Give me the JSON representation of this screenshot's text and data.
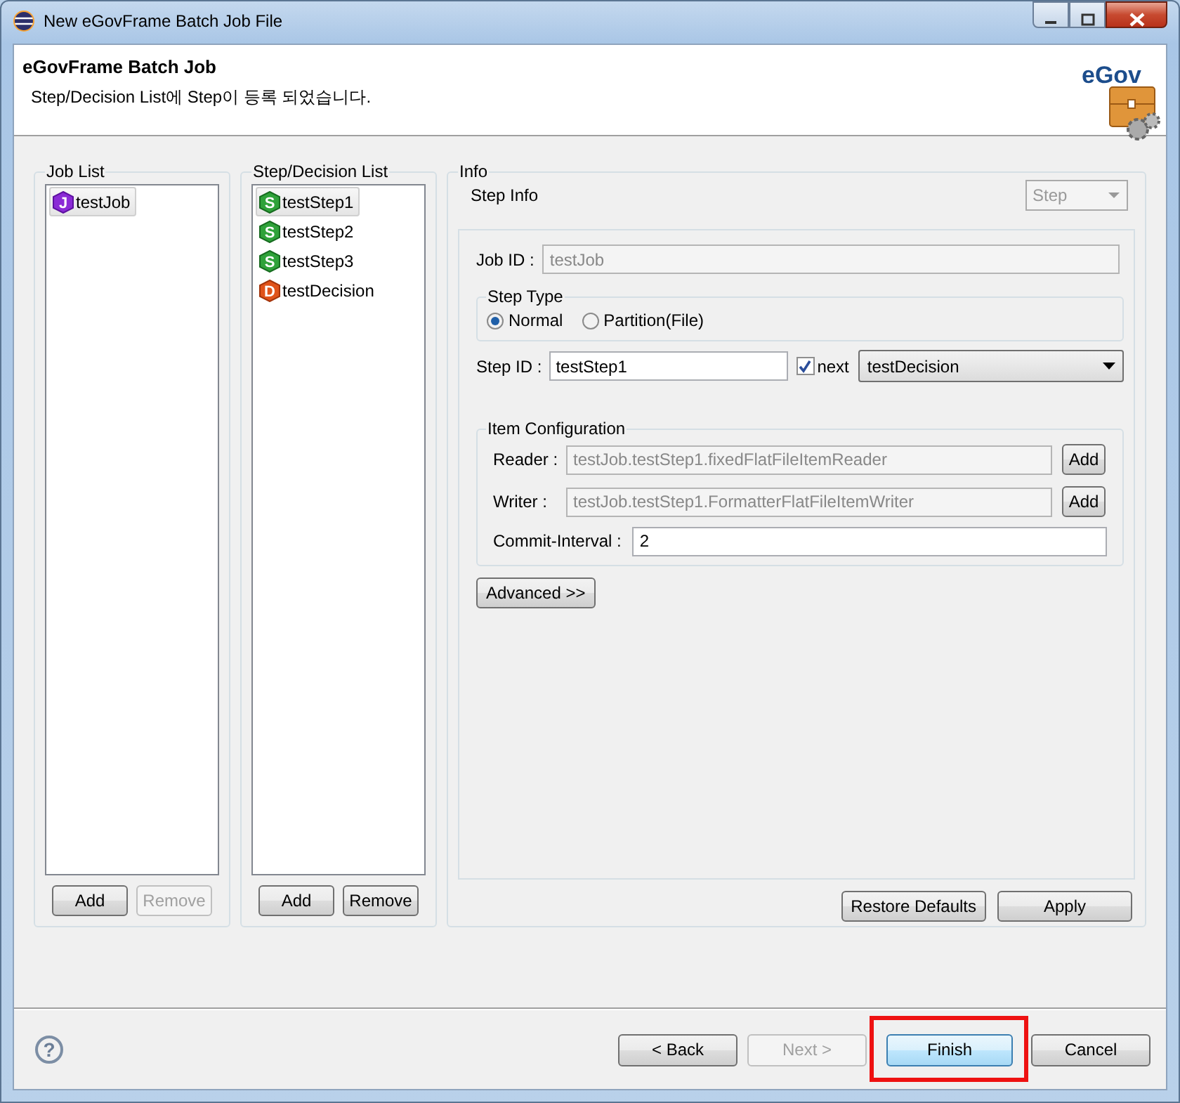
{
  "window": {
    "title": "New eGovFrame Batch Job File"
  },
  "header": {
    "title": "eGovFrame Batch Job",
    "message": "Step/Decision List에 Step이 등록 되었습니다.",
    "logo_text": "eGov"
  },
  "job_list": {
    "label": "Job List",
    "items": [
      {
        "badge": "J",
        "name": "testJob",
        "kind": "job",
        "selected": true
      }
    ],
    "buttons": [
      {
        "label": "Add",
        "disabled": false
      },
      {
        "label": "Remove",
        "disabled": true
      }
    ]
  },
  "step_list": {
    "label": "Step/Decision List",
    "items": [
      {
        "badge": "S",
        "name": "testStep1",
        "kind": "step",
        "selected": true
      },
      {
        "badge": "S",
        "name": "testStep2",
        "kind": "step",
        "selected": false
      },
      {
        "badge": "S",
        "name": "testStep3",
        "kind": "step",
        "selected": false
      },
      {
        "badge": "D",
        "name": "testDecision",
        "kind": "decision",
        "selected": false
      }
    ],
    "buttons": [
      {
        "label": "Add",
        "disabled": false
      },
      {
        "label": "Remove",
        "disabled": false
      }
    ]
  },
  "info": {
    "label": "Info",
    "section": "Step Info",
    "type_combo": {
      "value": "Step",
      "disabled": true
    },
    "job_id": {
      "label": "Job ID :",
      "value": "testJob",
      "disabled": true
    },
    "step_type": {
      "label": "Step Type",
      "options": [
        {
          "label": "Normal",
          "selected": true
        },
        {
          "label": "Partition(File)",
          "selected": false
        }
      ]
    },
    "step_id": {
      "label": "Step ID :",
      "value": "testStep1"
    },
    "next": {
      "label": "next",
      "checked": true,
      "value": "testDecision"
    },
    "item_config": {
      "label": "Item Configuration",
      "rows": [
        {
          "label": "Reader :",
          "value": "testJob.testStep1.fixedFlatFileItemReader",
          "button": "Add"
        },
        {
          "label": "Writer :",
          "value": "testJob.testStep1.FormatterFlatFileItemWriter",
          "button": "Add"
        }
      ],
      "commit": {
        "label": "Commit-Interval :",
        "value": "2"
      }
    },
    "advanced": "Advanced >>",
    "buttons": [
      {
        "label": "Restore Defaults"
      },
      {
        "label": "Apply"
      }
    ]
  },
  "footer": {
    "help": "?",
    "buttons": [
      {
        "label": "< Back",
        "disabled": false,
        "default": false,
        "highlighted": false
      },
      {
        "label": "Next >",
        "disabled": true,
        "default": false,
        "highlighted": false
      },
      {
        "label": "Finish",
        "disabled": false,
        "default": true,
        "highlighted": true
      },
      {
        "label": "Cancel",
        "disabled": false,
        "default": false,
        "highlighted": false
      }
    ]
  }
}
